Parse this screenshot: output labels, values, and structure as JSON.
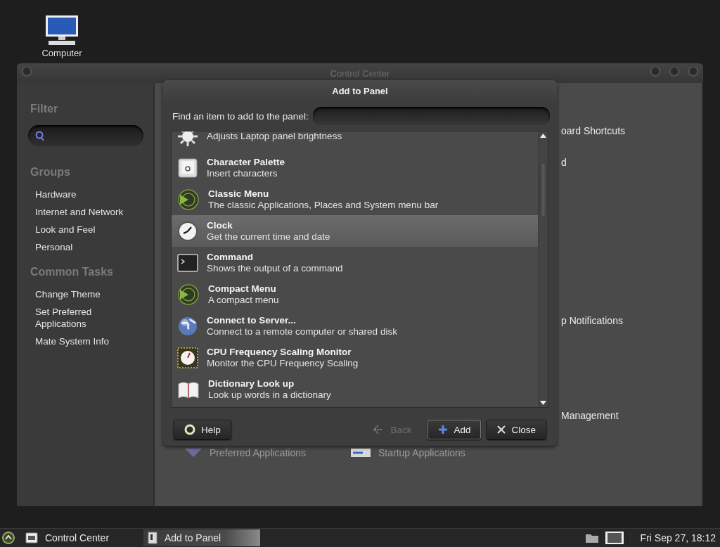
{
  "desktop_icons": [
    {
      "label": "Computer"
    }
  ],
  "window": {
    "title": "Control Center"
  },
  "sidebar": {
    "filter_heading": "Filter",
    "groups_heading": "Groups",
    "groups": [
      {
        "label": "Hardware"
      },
      {
        "label": "Internet and Network"
      },
      {
        "label": "Look and Feel"
      },
      {
        "label": "Personal"
      }
    ],
    "tasks_heading": "Common Tasks",
    "tasks": [
      {
        "label": "Change Theme"
      },
      {
        "label": "Set Preferred Applications"
      },
      {
        "label": "Mate System Info"
      }
    ]
  },
  "content_items": [
    {
      "label": "oard Shortcuts"
    },
    {
      "label": "d"
    },
    {
      "label": "p Notifications"
    },
    {
      "label": "Management"
    }
  ],
  "content_bottom": [
    {
      "label": "Preferred Applications",
      "kind": "preferred"
    },
    {
      "label": "Startup Applications",
      "kind": "startup"
    }
  ],
  "dialog": {
    "title": "Add to Panel",
    "search_label": "Find an item to add to the panel:",
    "items": [
      {
        "kind": "brightness",
        "description": "Adjusts Laptop panel brightness",
        "selected": false
      },
      {
        "kind": "charmap",
        "name": "Character Palette",
        "description": "Insert characters",
        "selected": false
      },
      {
        "kind": "menu",
        "name": "Classic Menu",
        "description": "The classic Applications, Places and System menu bar",
        "selected": false
      },
      {
        "kind": "clock",
        "name": "Clock",
        "description": "Get the current time and date",
        "selected": true
      },
      {
        "kind": "terminal",
        "name": "Command",
        "description": "Shows the output of a command",
        "selected": false
      },
      {
        "kind": "menu",
        "name": "Compact Menu",
        "description": "A compact menu",
        "selected": false
      },
      {
        "kind": "globe",
        "name": "Connect to Server...",
        "description": "Connect to a remote computer or shared disk",
        "selected": false
      },
      {
        "kind": "cpu",
        "name": "CPU Frequency Scaling Monitor",
        "description": "Monitor the CPU Frequency Scaling",
        "selected": false
      },
      {
        "kind": "book",
        "name": "Dictionary Look up",
        "description": "Look up words in a dictionary",
        "selected": false
      }
    ],
    "buttons": [
      {
        "kind": "help",
        "label": "Help",
        "disabled": false
      },
      {
        "kind": "back",
        "label": "Back",
        "disabled": true
      },
      {
        "kind": "add",
        "label": "Add",
        "disabled": false
      },
      {
        "kind": "close",
        "label": "Close",
        "disabled": false
      }
    ]
  },
  "taskbar": {
    "tasks": [
      {
        "kind": "control",
        "label": "Control Center",
        "selected": false
      },
      {
        "kind": "panel",
        "label": "Add to Panel",
        "selected": true
      }
    ],
    "clock": "Fri Sep 27, 18:12"
  }
}
